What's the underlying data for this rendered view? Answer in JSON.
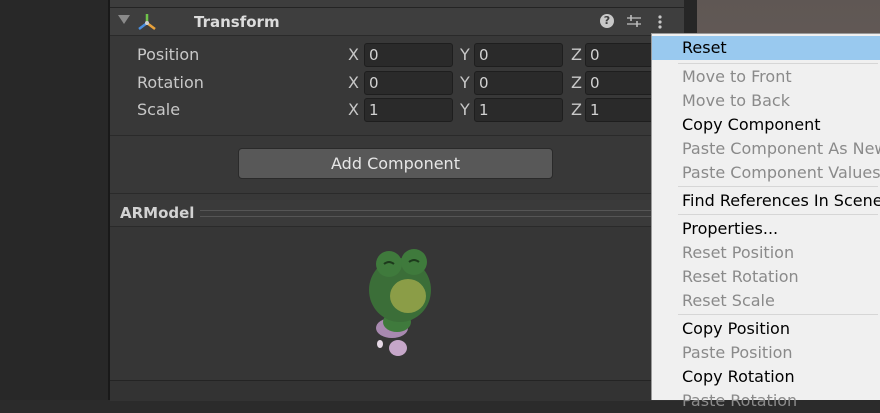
{
  "component": {
    "title": "Transform",
    "rows": [
      {
        "label": "Position",
        "x": "0",
        "y": "0",
        "z": "0"
      },
      {
        "label": "Rotation",
        "x": "0",
        "y": "0",
        "z": "0"
      },
      {
        "label": "Scale",
        "x": "1",
        "y": "1",
        "z": "1"
      }
    ],
    "axes": {
      "x": "X",
      "y": "Y",
      "z": "Z"
    }
  },
  "add_component_label": "Add Component",
  "preview": {
    "title": "ARModel"
  },
  "context_menu": {
    "items": [
      {
        "label": "Reset",
        "enabled": true,
        "highlighted": true
      },
      {
        "label": "Move to Front",
        "enabled": false
      },
      {
        "label": "Move to Back",
        "enabled": false
      },
      {
        "label": "Copy Component",
        "enabled": true
      },
      {
        "label": "Paste Component As New",
        "enabled": false
      },
      {
        "label": "Paste Component Values",
        "enabled": false
      },
      {
        "label": "Find References In Scene",
        "enabled": true
      },
      {
        "label": "Properties...",
        "enabled": true
      },
      {
        "label": "Reset Position",
        "enabled": false
      },
      {
        "label": "Reset Rotation",
        "enabled": false
      },
      {
        "label": "Reset Scale",
        "enabled": false
      },
      {
        "label": "Copy Position",
        "enabled": true
      },
      {
        "label": "Paste Position",
        "enabled": false
      },
      {
        "label": "Copy Rotation",
        "enabled": true
      },
      {
        "label": "Paste Rotation",
        "enabled": false
      }
    ]
  },
  "icons": {
    "foldout": "triangle-down-icon",
    "component": "transform-icon",
    "help": "help-icon",
    "presets": "presets-icon",
    "menu": "kebab-menu-icon"
  },
  "colors": {
    "highlight": "#99c9ef",
    "menu_bg": "#f0f0f0",
    "panel_bg": "#383838"
  }
}
